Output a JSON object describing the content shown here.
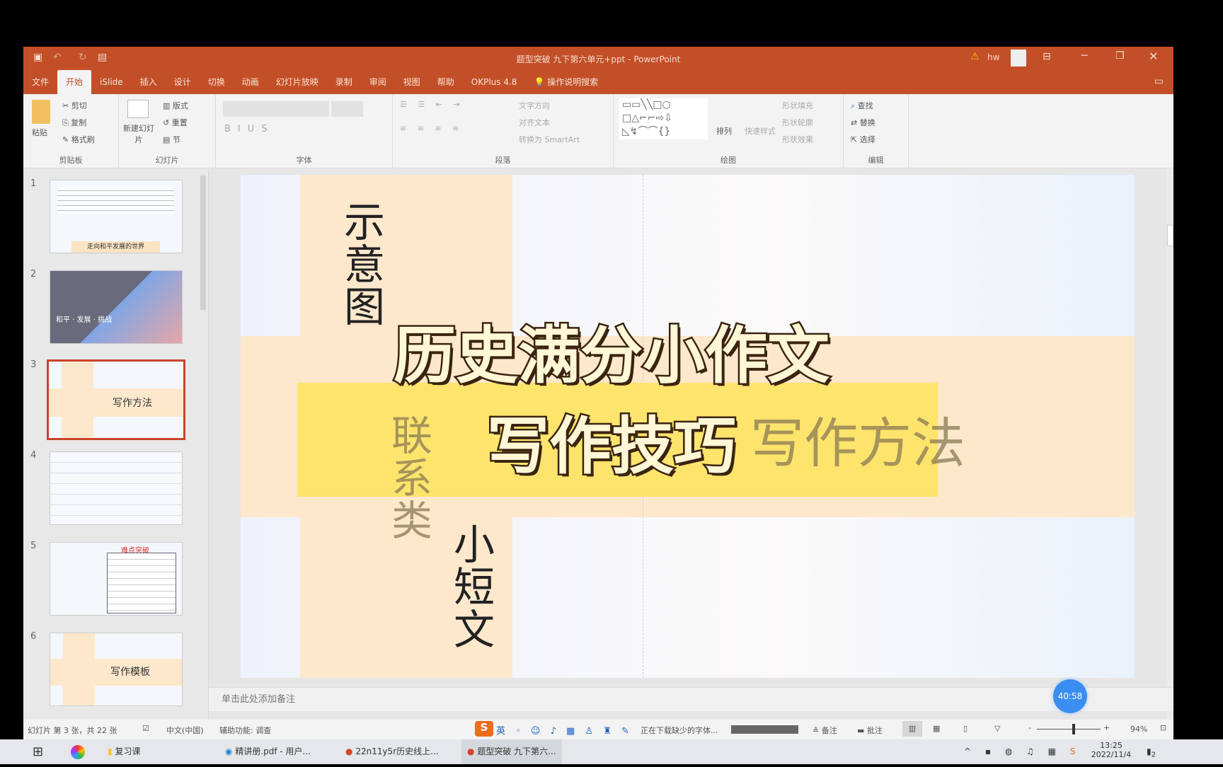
{
  "window": {
    "title": "题型突破 九下第六单元+ppt - PowerPoint",
    "user": "hw",
    "accent": "#c24f27"
  },
  "tabs": [
    "文件",
    "开始",
    "iSlide",
    "插入",
    "设计",
    "切换",
    "动画",
    "幻灯片放映",
    "录制",
    "审阅",
    "视图",
    "帮助",
    "OKPlus 4.8"
  ],
  "tell_me": "操作说明搜索",
  "ribbon": {
    "clipboard": {
      "label": "剪贴板",
      "paste": "粘贴",
      "cut": "剪切",
      "copy": "复制",
      "painter": "格式刷"
    },
    "slides": {
      "label": "幻灯片",
      "new": "新建幻灯片",
      "layout": "版式",
      "reset": "重置",
      "section": "节"
    },
    "font": {
      "label": "字体"
    },
    "paragraph": {
      "label": "段落",
      "dir": "文字方向",
      "align": "对齐文本",
      "smartart": "转换为 SmartArt"
    },
    "drawing": {
      "label": "绘图",
      "arrange": "排列",
      "quick": "快速样式",
      "fill": "形状填充",
      "outline": "形状轮廓",
      "effect": "形状效果"
    },
    "editing": {
      "label": "编辑",
      "find": "查找",
      "replace": "替换",
      "select": "选择"
    }
  },
  "thumbnails": [
    {
      "n": "1",
      "caption": "走向和平发展的世界"
    },
    {
      "n": "2",
      "caption": "和平 · 发展 · 挑战"
    },
    {
      "n": "3",
      "caption": "写作方法"
    },
    {
      "n": "4",
      "caption": ""
    },
    {
      "n": "5",
      "caption": "难点突破"
    },
    {
      "n": "6",
      "caption": "写作模板"
    }
  ],
  "slide": {
    "v1": "示意图",
    "v2": "联系类",
    "v3": "小短文",
    "main": "写作方法"
  },
  "overlay": {
    "line1": "历史满分小作文",
    "line2": "写作技巧",
    "band_color": "#fde46c"
  },
  "notes_placeholder": "单击此处添加备注",
  "timer": "40:58",
  "status": {
    "slide": "幻灯片 第 3 张，共 22 张",
    "lang": "中文(中国)",
    "access": "辅助功能: 调查",
    "download": "正在下载缺少的字体...",
    "notes": "备注",
    "comments": "批注",
    "zoom": "94%",
    "zoom_level": 94
  },
  "taskbar": {
    "items": [
      "复习课",
      "精讲册.pdf - 用户...",
      "22n11y5r历史线上...",
      "题型突破 九下第六..."
    ],
    "time": "13:25",
    "date": "2022/11/4",
    "notif": "2"
  }
}
